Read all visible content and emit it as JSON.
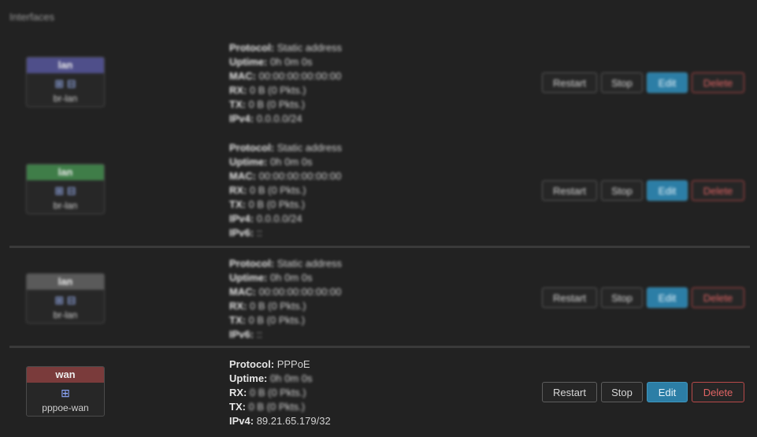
{
  "section": {
    "title": "Interfaces"
  },
  "interfaces": [
    {
      "name": "lan",
      "device": "br-lan",
      "head_color": "#4f4f8a",
      "info": [
        {
          "k": "Protocol:",
          "v": "Static address"
        },
        {
          "k": "Uptime:",
          "v": "0h 0m 0s"
        },
        {
          "k": "MAC:",
          "v": "00:00:00:00:00:00"
        },
        {
          "k": "RX:",
          "v": "0 B (0 Pkts.)"
        },
        {
          "k": "TX:",
          "v": "0 B (0 Pkts.)"
        },
        {
          "k": "IPv4:",
          "v": "0.0.0.0/24"
        }
      ]
    },
    {
      "name": "lan",
      "device": "br-lan",
      "head_color": "#3f7d48",
      "info": [
        {
          "k": "Protocol:",
          "v": "Static address"
        },
        {
          "k": "Uptime:",
          "v": "0h 0m 0s"
        },
        {
          "k": "MAC:",
          "v": "00:00:00:00:00:00"
        },
        {
          "k": "RX:",
          "v": "0 B (0 Pkts.)"
        },
        {
          "k": "TX:",
          "v": "0 B (0 Pkts.)"
        },
        {
          "k": "IPv4:",
          "v": "0.0.0.0/24"
        },
        {
          "k": "IPv6:",
          "v": "::"
        }
      ]
    },
    {
      "name": "lan",
      "device": "br-lan",
      "head_color": "#5a5a5a",
      "info": [
        {
          "k": "Protocol:",
          "v": "Static address"
        },
        {
          "k": "Uptime:",
          "v": "0h 0m 0s"
        },
        {
          "k": "MAC:",
          "v": "00:00:00:00:00:00"
        },
        {
          "k": "RX:",
          "v": "0 B (0 Pkts.)"
        },
        {
          "k": "TX:",
          "v": "0 B (0 Pkts.)"
        },
        {
          "k": "IPv6:",
          "v": "::"
        }
      ]
    },
    {
      "name": "wan",
      "device": "pppoe-wan",
      "head_color": "#7a3b3b",
      "info": [
        {
          "k": "Protocol:",
          "v": "PPPoE"
        },
        {
          "k": "Uptime:",
          "v": "0h 0m 0s"
        },
        {
          "k": "RX:",
          "v": "0 B (0 Pkts.)"
        },
        {
          "k": "TX:",
          "v": "0 B (0 Pkts.)"
        },
        {
          "k": "IPv4:",
          "v": "89.21.65.179/32"
        }
      ]
    }
  ],
  "buttons": {
    "restart": "Restart",
    "stop": "Stop",
    "edit": "Edit",
    "delete": "Delete"
  },
  "icons": {
    "interface": "network-ports-icon"
  }
}
